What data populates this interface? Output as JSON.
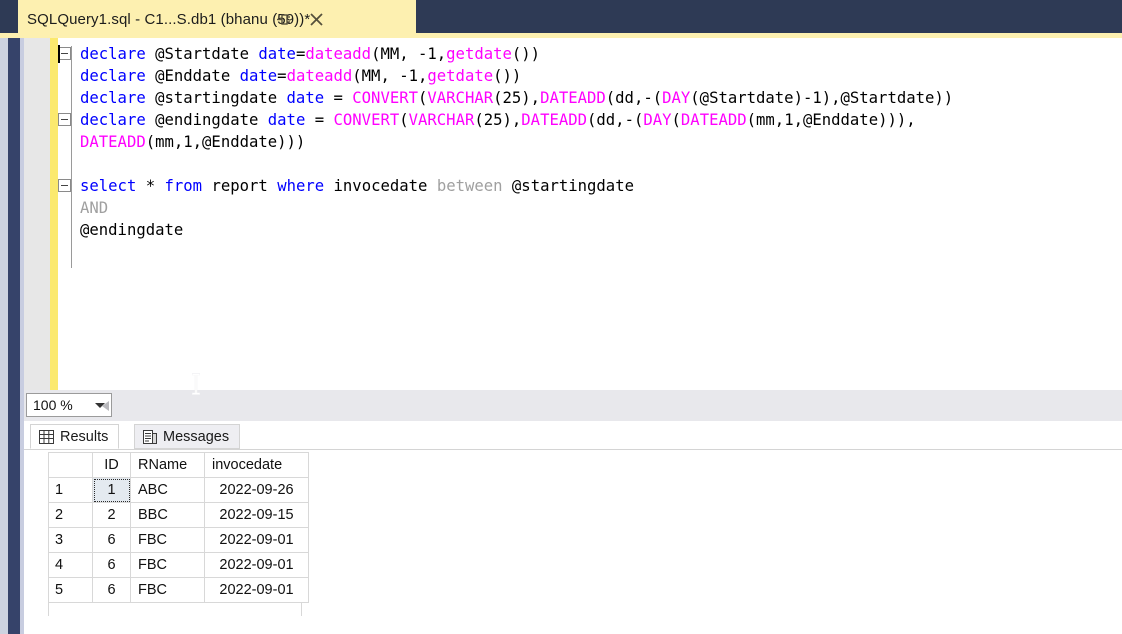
{
  "window": {
    "tab_title": "SQLQuery1.sql - C1...S.db1 (bhanu (59))*",
    "pin_icon": "pin-icon",
    "close_icon": "close-icon",
    "accent_navy": "#2e3a55",
    "tab_background": "#fdf0b0"
  },
  "editor": {
    "caret_visible": true,
    "change_bar_color": "#fbe96e",
    "lines": [
      {
        "fold": true,
        "tokens": [
          {
            "t": "declare",
            "c": "kw"
          },
          {
            "t": " @Startdate ",
            "c": "plain"
          },
          {
            "t": "date",
            "c": "type"
          },
          {
            "t": "=",
            "c": "plain"
          },
          {
            "t": "dateadd",
            "c": "fn"
          },
          {
            "t": "(MM, -1,",
            "c": "plain"
          },
          {
            "t": "getdate",
            "c": "fn"
          },
          {
            "t": "())",
            "c": "plain"
          }
        ]
      },
      {
        "fold": false,
        "tokens": [
          {
            "t": "declare",
            "c": "kw"
          },
          {
            "t": " @Enddate ",
            "c": "plain"
          },
          {
            "t": "date",
            "c": "type"
          },
          {
            "t": "=",
            "c": "plain"
          },
          {
            "t": "dateadd",
            "c": "fn"
          },
          {
            "t": "(MM, -1,",
            "c": "plain"
          },
          {
            "t": "getdate",
            "c": "fn"
          },
          {
            "t": "())",
            "c": "plain"
          }
        ]
      },
      {
        "fold": false,
        "tokens": [
          {
            "t": "declare",
            "c": "kw"
          },
          {
            "t": " @startingdate ",
            "c": "plain"
          },
          {
            "t": "date",
            "c": "type"
          },
          {
            "t": " = ",
            "c": "plain"
          },
          {
            "t": "CONVERT",
            "c": "fn"
          },
          {
            "t": "(",
            "c": "plain"
          },
          {
            "t": "VARCHAR",
            "c": "fn"
          },
          {
            "t": "(25),",
            "c": "plain"
          },
          {
            "t": "DATEADD",
            "c": "fn"
          },
          {
            "t": "(dd,-(",
            "c": "plain"
          },
          {
            "t": "DAY",
            "c": "fn"
          },
          {
            "t": "(@Startdate)-1),@Startdate))",
            "c": "plain"
          }
        ]
      },
      {
        "fold": true,
        "tokens": [
          {
            "t": "declare",
            "c": "kw"
          },
          {
            "t": " @endingdate ",
            "c": "plain"
          },
          {
            "t": "date",
            "c": "type"
          },
          {
            "t": " = ",
            "c": "plain"
          },
          {
            "t": "CONVERT",
            "c": "fn"
          },
          {
            "t": "(",
            "c": "plain"
          },
          {
            "t": "VARCHAR",
            "c": "fn"
          },
          {
            "t": "(25),",
            "c": "plain"
          },
          {
            "t": "DATEADD",
            "c": "fn"
          },
          {
            "t": "(dd,-(",
            "c": "plain"
          },
          {
            "t": "DAY",
            "c": "fn"
          },
          {
            "t": "(",
            "c": "plain"
          },
          {
            "t": "DATEADD",
            "c": "fn"
          },
          {
            "t": "(mm,1,@Enddate))),",
            "c": "plain"
          }
        ]
      },
      {
        "fold": false,
        "tokens": [
          {
            "t": "DATEADD",
            "c": "fn"
          },
          {
            "t": "(mm,1,@Enddate)))",
            "c": "plain"
          }
        ]
      },
      {
        "fold": false,
        "tokens": []
      },
      {
        "fold": true,
        "tokens": [
          {
            "t": "select",
            "c": "kw"
          },
          {
            "t": " * ",
            "c": "plain"
          },
          {
            "t": "from",
            "c": "kw"
          },
          {
            "t": " report ",
            "c": "plain"
          },
          {
            "t": "where",
            "c": "kw"
          },
          {
            "t": " invocedate ",
            "c": "plain"
          },
          {
            "t": "between",
            "c": "dim"
          },
          {
            "t": " @startingdate",
            "c": "plain"
          }
        ]
      },
      {
        "fold": false,
        "tokens": [
          {
            "t": "AND",
            "c": "dim"
          }
        ]
      },
      {
        "fold": false,
        "tokens": [
          {
            "t": "@endingdate",
            "c": "plain"
          }
        ]
      }
    ]
  },
  "status": {
    "zoom_level": "100 %",
    "zoom_dropdown_icon": "chevron-down-icon",
    "scroll_left_icon": "scroll-left-arrow-icon"
  },
  "results": {
    "tabs": [
      {
        "label": "Results",
        "icon": "results-grid-icon",
        "active": true
      },
      {
        "label": "Messages",
        "icon": "messages-icon",
        "active": false
      }
    ],
    "grid": {
      "columns": [
        "",
        "ID",
        "RName",
        "invocedate"
      ],
      "rows": [
        {
          "n": "1",
          "id": "1",
          "rname": "ABC",
          "date": "2022-09-26",
          "focused": true
        },
        {
          "n": "2",
          "id": "2",
          "rname": "BBC",
          "date": "2022-09-15",
          "focused": false
        },
        {
          "n": "3",
          "id": "6",
          "rname": "FBC",
          "date": "2022-09-01",
          "focused": false
        },
        {
          "n": "4",
          "id": "6",
          "rname": "FBC",
          "date": "2022-09-01",
          "focused": false
        },
        {
          "n": "5",
          "id": "6",
          "rname": "FBC",
          "date": "2022-09-01",
          "focused": false
        }
      ]
    }
  }
}
